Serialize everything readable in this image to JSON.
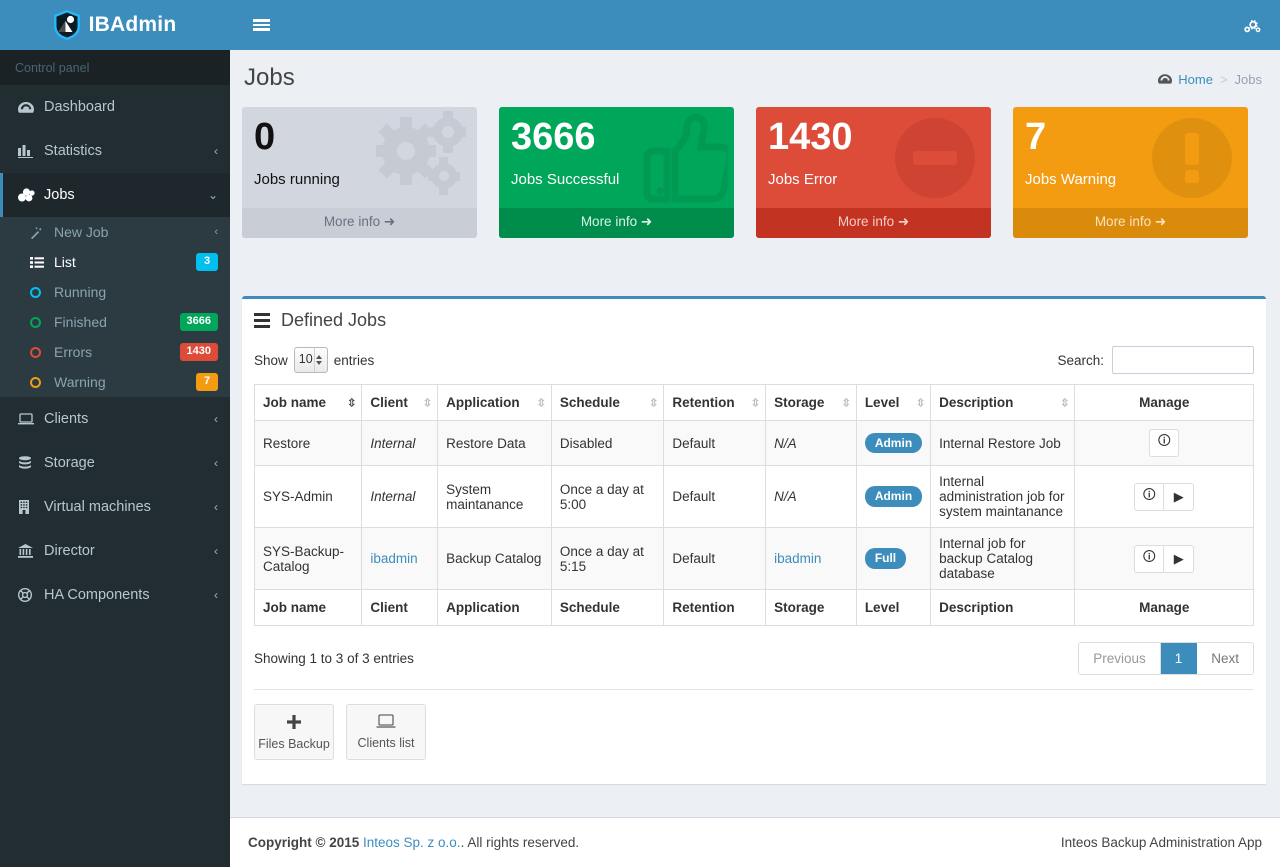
{
  "brand": {
    "name": "IBAdmin",
    "logo_icon": "shield-logo-icon"
  },
  "topbar": {
    "menu_toggle_icon": "hamburger-menu-icon",
    "settings_icon": "gears-icon"
  },
  "sidebar": {
    "header": "Control panel",
    "items": [
      {
        "label": "Dashboard",
        "icon": "dashboard-icon",
        "arrow": "",
        "active": false
      },
      {
        "label": "Statistics",
        "icon": "bar-chart-icon",
        "arrow": "‹",
        "active": false
      },
      {
        "label": "Jobs",
        "icon": "jobs-cubes-icon",
        "arrow": "⌄",
        "active": true
      },
      {
        "label": "Clients",
        "icon": "laptop-icon",
        "arrow": "‹",
        "active": false
      },
      {
        "label": "Storage",
        "icon": "database-icon",
        "arrow": "‹",
        "active": false
      },
      {
        "label": "Virtual machines",
        "icon": "building-icon",
        "arrow": "‹",
        "active": false
      },
      {
        "label": "Director",
        "icon": "bank-icon",
        "arrow": "‹",
        "active": false
      },
      {
        "label": "HA Components",
        "icon": "lifebuoy-icon",
        "arrow": "‹",
        "active": false
      }
    ],
    "jobs_submenu": [
      {
        "label": "New Job",
        "icon": "magic-wand-icon",
        "badge": "",
        "badge_color": "",
        "arrow": "‹",
        "selected": false
      },
      {
        "label": "List",
        "icon": "list-icon",
        "badge": "3",
        "badge_color": "#00c0ef",
        "arrow": "",
        "selected": true
      },
      {
        "label": "Running",
        "icon": "circle-o-icon",
        "badge": "",
        "badge_color": "",
        "icon_color": "#00c0ef",
        "arrow": "",
        "selected": false
      },
      {
        "label": "Finished",
        "icon": "circle-o-icon",
        "badge": "3666",
        "badge_color": "#00a65a",
        "icon_color": "#00a65a",
        "arrow": "",
        "selected": false
      },
      {
        "label": "Errors",
        "icon": "circle-o-icon",
        "badge": "1430",
        "badge_color": "#dd4b39",
        "icon_color": "#dd4b39",
        "arrow": "",
        "selected": false
      },
      {
        "label": "Warning",
        "icon": "circle-o-icon",
        "badge": "7",
        "badge_color": "#f39c12",
        "icon_color": "#f39c12",
        "arrow": "",
        "selected": false
      }
    ]
  },
  "page": {
    "title": "Jobs",
    "breadcrumb": {
      "home": "Home",
      "home_icon": "dashboard-icon",
      "separator": ">",
      "current": "Jobs"
    }
  },
  "info_boxes": [
    {
      "number": "0",
      "label": "Jobs running",
      "more": "More info",
      "style": "box-grey",
      "icon": "gears-icon"
    },
    {
      "number": "3666",
      "label": "Jobs Successful",
      "more": "More info",
      "style": "box-green",
      "icon": "thumbs-up-icon"
    },
    {
      "number": "1430",
      "label": "Jobs Error",
      "more": "More info",
      "style": "box-red",
      "icon": "minus-circle-icon"
    },
    {
      "number": "7",
      "label": "Jobs Warning",
      "more": "More info",
      "style": "box-yellow",
      "icon": "exclamation-circle-icon"
    }
  ],
  "panel": {
    "title": "Defined Jobs",
    "title_icon": "list-icon",
    "show_label": "Show",
    "entries_label": "entries",
    "page_length": "10",
    "search_label": "Search:",
    "search_value": "",
    "search_placeholder": "",
    "columns": [
      "Job name",
      "Client",
      "Application",
      "Schedule",
      "Retention",
      "Storage",
      "Level",
      "Description",
      "Manage"
    ],
    "rows": [
      {
        "job_name": "Restore",
        "client": "Internal",
        "client_link": false,
        "application": "Restore Data",
        "schedule": "Disabled",
        "retention": "Default",
        "storage": "N/A",
        "storage_link": false,
        "level": "Admin",
        "description": "Internal Restore Job",
        "actions": [
          "info-icon"
        ]
      },
      {
        "job_name": "SYS-Admin",
        "client": "Internal",
        "client_link": false,
        "application": "System maintanance",
        "schedule": "Once a day at 5:00",
        "retention": "Default",
        "storage": "N/A",
        "storage_link": false,
        "level": "Admin",
        "description": "Internal administration job for system maintanance",
        "actions": [
          "info-icon",
          "run-icon"
        ]
      },
      {
        "job_name": "SYS-Backup-Catalog",
        "client": "ibadmin",
        "client_link": true,
        "application": "Backup Catalog",
        "schedule": "Once a day at 5:15",
        "retention": "Default",
        "storage": "ibadmin",
        "storage_link": true,
        "level": "Full",
        "description": "Internal job for backup Catalog database",
        "actions": [
          "info-icon",
          "run-icon"
        ]
      }
    ],
    "info_text": "Showing 1 to 3 of 3 entries",
    "pagination": {
      "previous": "Previous",
      "pages": [
        "1"
      ],
      "next": "Next",
      "current": "1"
    },
    "actions": [
      {
        "label": "Files Backup",
        "icon": "plus-icon"
      },
      {
        "label": "Clients list",
        "icon": "laptop-icon"
      }
    ]
  },
  "footer": {
    "copyright_prefix": "Copyright © 2015",
    "company": "Inteos Sp. z o.o.",
    "copyright_suffix": ". All rights reserved.",
    "right": "Inteos Backup Administration App"
  }
}
